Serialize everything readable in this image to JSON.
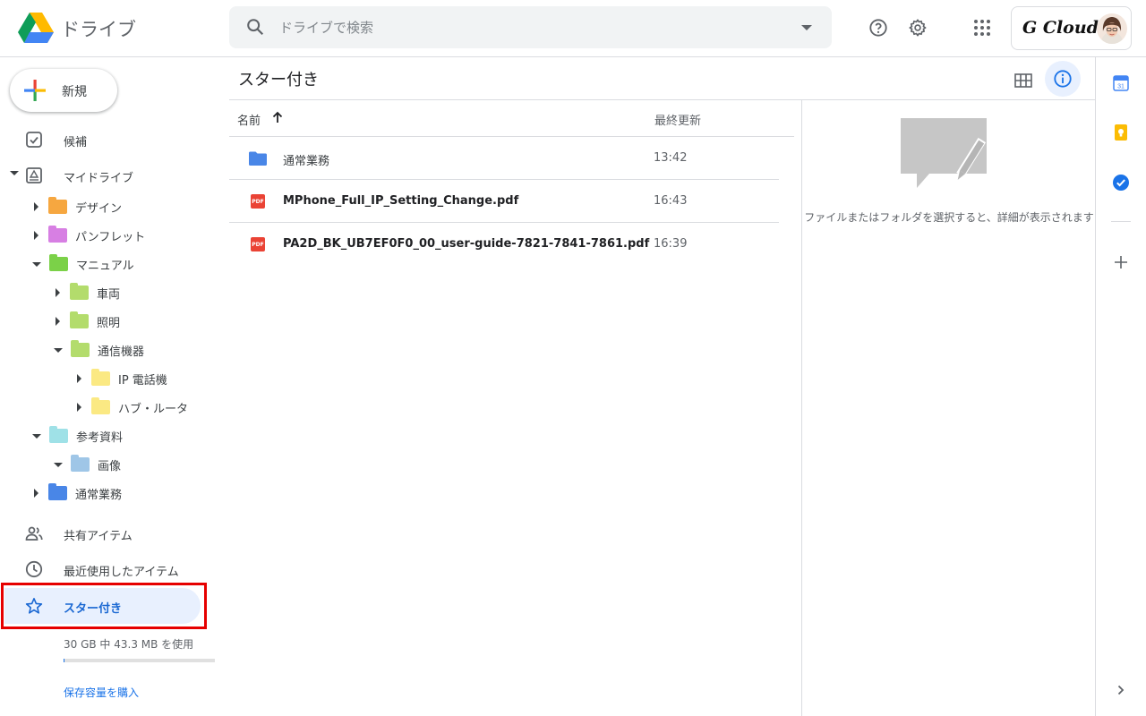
{
  "header": {
    "app_title": "ドライブ",
    "search_placeholder": "ドライブで検索",
    "account_brand": "G Cloud"
  },
  "sidebar": {
    "new_label": "新規",
    "nav_top": [
      {
        "label": "候補",
        "icon": "check-square-icon"
      },
      {
        "label": "マイドライブ",
        "icon": "my-drive-icon"
      }
    ],
    "tree": [
      {
        "label": "デザイン",
        "color": "#f6a740"
      },
      {
        "label": "パンフレット",
        "color": "#d77fe3"
      },
      {
        "label": "マニュアル",
        "color": "#7bd148"
      },
      {
        "label": "車両",
        "color": "#b3dc6c"
      },
      {
        "label": "照明",
        "color": "#b3dc6c"
      },
      {
        "label": "通信機器",
        "color": "#b3dc6c"
      },
      {
        "label": "IP 電話機",
        "color": "#fbe983"
      },
      {
        "label": "ハブ・ルータ",
        "color": "#fbe983"
      },
      {
        "label": "参考資料",
        "color": "#9fe1e7"
      },
      {
        "label": "画像",
        "color": "#9fc6e7"
      },
      {
        "label": "通常業務",
        "color": "#4986e7"
      }
    ],
    "nav_bottom": [
      {
        "label": "共有アイテム",
        "icon": "shared-people-icon"
      },
      {
        "label": "最近使用したアイテム",
        "icon": "clock-icon"
      },
      {
        "label": "スター付き",
        "icon": "star-icon"
      }
    ],
    "storage_text": "30 GB 中 43.3 MB を使用",
    "storage_used_fraction": 0.0014,
    "buy_storage": "保存容量を購入"
  },
  "main": {
    "title": "スター付き",
    "col_name": "名前",
    "col_modified": "最終更新",
    "files": [
      {
        "name": "通常業務",
        "time": "13:42",
        "type": "folder"
      },
      {
        "name": "MPhone_Full_IP_Setting_Change.pdf",
        "time": "16:43",
        "type": "pdf"
      },
      {
        "name": "PA2D_BK_UB7EF0F0_00_user-guide-7821-7841-7861.pdf",
        "time": "16:39",
        "type": "pdf"
      }
    ],
    "pdf_badge": "PDF"
  },
  "details": {
    "message": "ファイルまたはフォルダを選択すると、詳細が表示されます"
  },
  "colors": {
    "accent": "#1a73e8",
    "active_bg": "#e8f0fe",
    "highlight": "#e60000"
  }
}
